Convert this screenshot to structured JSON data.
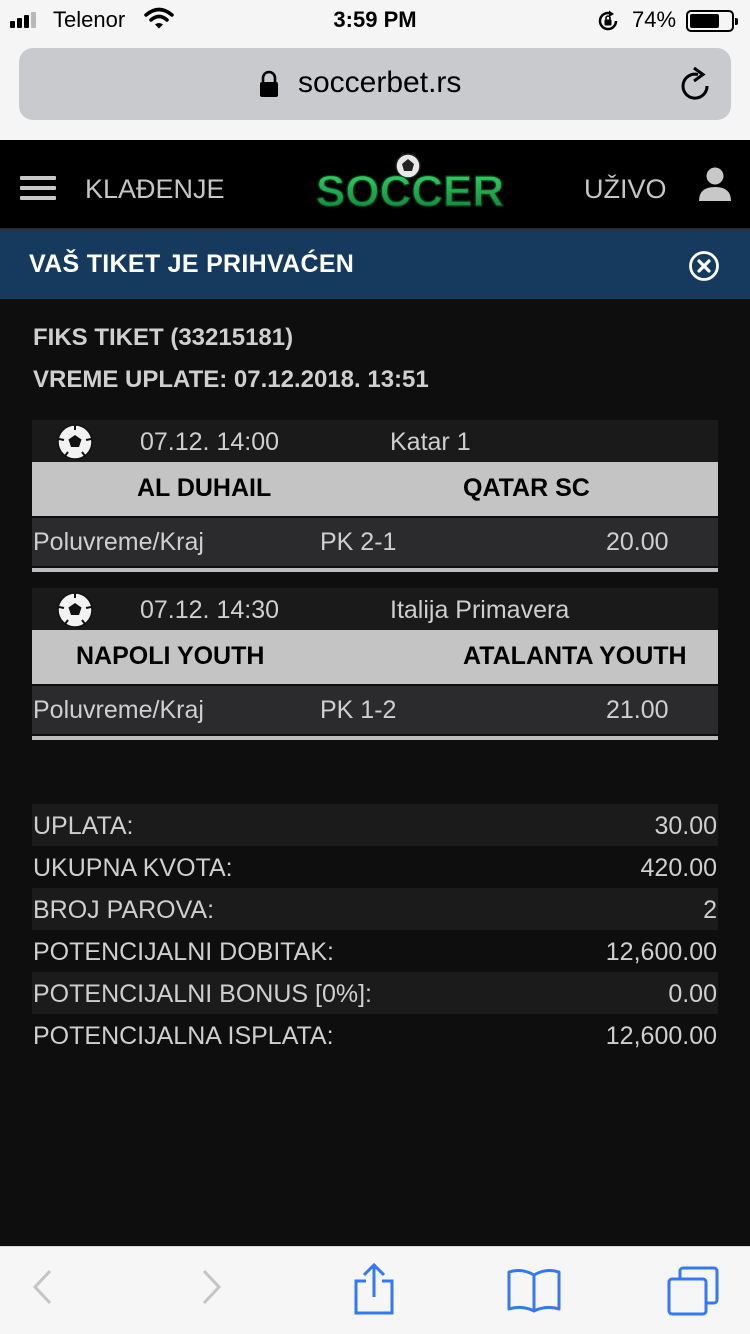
{
  "status_bar": {
    "carrier": "Telenor",
    "time": "3:59 PM",
    "battery_percent": "74%",
    "battery_level": 0.74,
    "icons": [
      "signal-icon",
      "wifi-icon",
      "rotation-lock-icon",
      "battery-icon"
    ]
  },
  "browser": {
    "url": "soccerbet.rs",
    "icons": [
      "padlock-icon",
      "reload-icon"
    ]
  },
  "site_header": {
    "menu_label": "KLAĐENJE",
    "live_label": "UŽIVO",
    "logo_text": "SOCCER",
    "icons": [
      "hamburger-icon",
      "user-icon"
    ]
  },
  "banner": {
    "title": "VAŠ TIKET JE PRIHVAĆEN",
    "icon": "close-circle-icon",
    "color": "#163a5e"
  },
  "ticket": {
    "line1": "FIKS TIKET (33215181)",
    "line2": "VREME UPLATE: 07.12.2018. 13:51"
  },
  "matches": [
    {
      "datetime": "07.12. 14:00",
      "league": "Katar 1",
      "home": "AL DUHAIL",
      "away": "QATAR SC",
      "market": "Poluvreme/Kraj",
      "pick": "PK 2-1",
      "odds": "20.00"
    },
    {
      "datetime": "07.12. 14:30",
      "league": "Italija Primavera",
      "home": "NAPOLI YOUTH",
      "away": "ATALANTA YOUTH",
      "market": "Poluvreme/Kraj",
      "pick": "PK 1-2",
      "odds": "21.00"
    }
  ],
  "summary": [
    {
      "label": "UPLATA:",
      "value": "30.00"
    },
    {
      "label": "UKUPNA KVOTA:",
      "value": "420.00"
    },
    {
      "label": "BROJ PAROVA:",
      "value": "2"
    },
    {
      "label": "POTENCIJALNI DOBITAK:",
      "value": "12,600.00"
    },
    {
      "label": "POTENCIJALNI BONUS [0%]:",
      "value": "0.00"
    },
    {
      "label": "POTENCIJALNA ISPLATA:",
      "value": "12,600.00"
    }
  ],
  "toolbar": {
    "icons": [
      "back-icon",
      "forward-icon",
      "share-icon",
      "bookmarks-icon",
      "tabs-icon"
    ],
    "accent": "#3478f6"
  }
}
